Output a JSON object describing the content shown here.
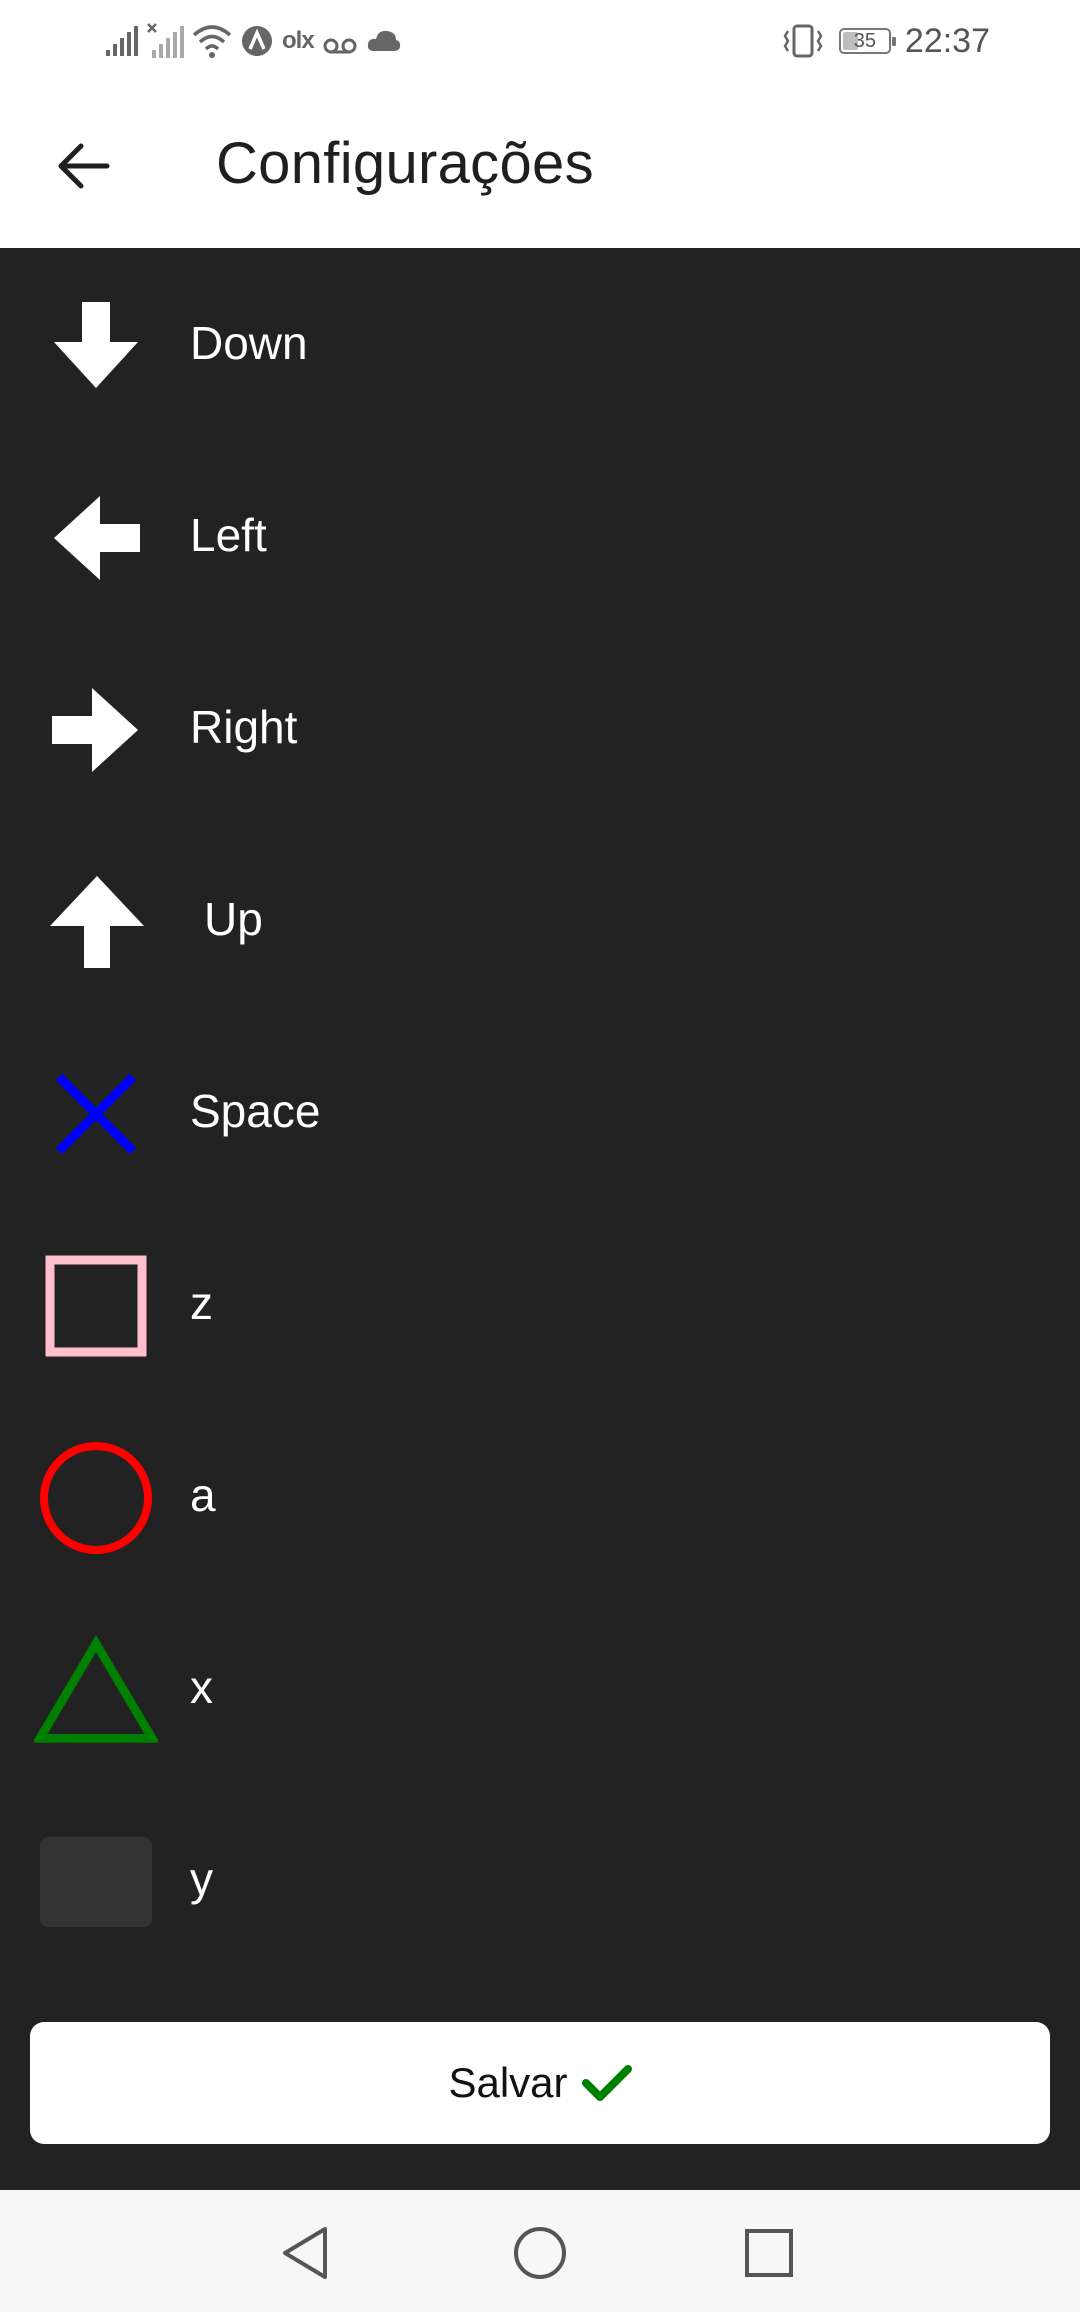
{
  "status_bar": {
    "time": "22:37",
    "battery_level": "35",
    "battery_fraction": 0.35,
    "carrier_text": "olx",
    "icons": [
      "signal-icon",
      "signal-no-sim-icon",
      "wifi-icon",
      "app-a-icon",
      "olx-icon",
      "voicemail-icon",
      "cloud-icon",
      "vibrate-icon",
      "battery-icon"
    ]
  },
  "header": {
    "title": "Configurações",
    "back_icon": "arrow-left-icon"
  },
  "mappings": [
    {
      "label": "Down",
      "icon": "arrow-down-icon",
      "color": "#ffffff"
    },
    {
      "label": "Left",
      "icon": "arrow-left-icon",
      "color": "#ffffff"
    },
    {
      "label": "Right",
      "icon": "arrow-right-icon",
      "color": "#ffffff"
    },
    {
      "label": "Up",
      "icon": "arrow-up-icon",
      "color": "#ffffff"
    },
    {
      "label": "Space",
      "icon": "cross-icon",
      "color": "#0000ff"
    },
    {
      "label": "z",
      "icon": "square-icon",
      "color": "#ffc0cb"
    },
    {
      "label": "a",
      "icon": "circle-icon",
      "color": "#ff0000"
    },
    {
      "label": "x",
      "icon": "triangle-icon",
      "color": "#008000"
    },
    {
      "label": "y",
      "icon": "blank-key-icon",
      "color": "#333333"
    }
  ],
  "save_button": {
    "label": "Salvar",
    "icon": "checkmark-icon",
    "icon_color": "#008000"
  },
  "colors": {
    "background": "#222222",
    "header_background": "#ffffff",
    "title_text": "#1f1f1f",
    "label_text": "#ffffff"
  },
  "nav_bar": {
    "buttons": [
      "back-triangle-icon",
      "home-circle-icon",
      "recents-square-icon"
    ]
  }
}
